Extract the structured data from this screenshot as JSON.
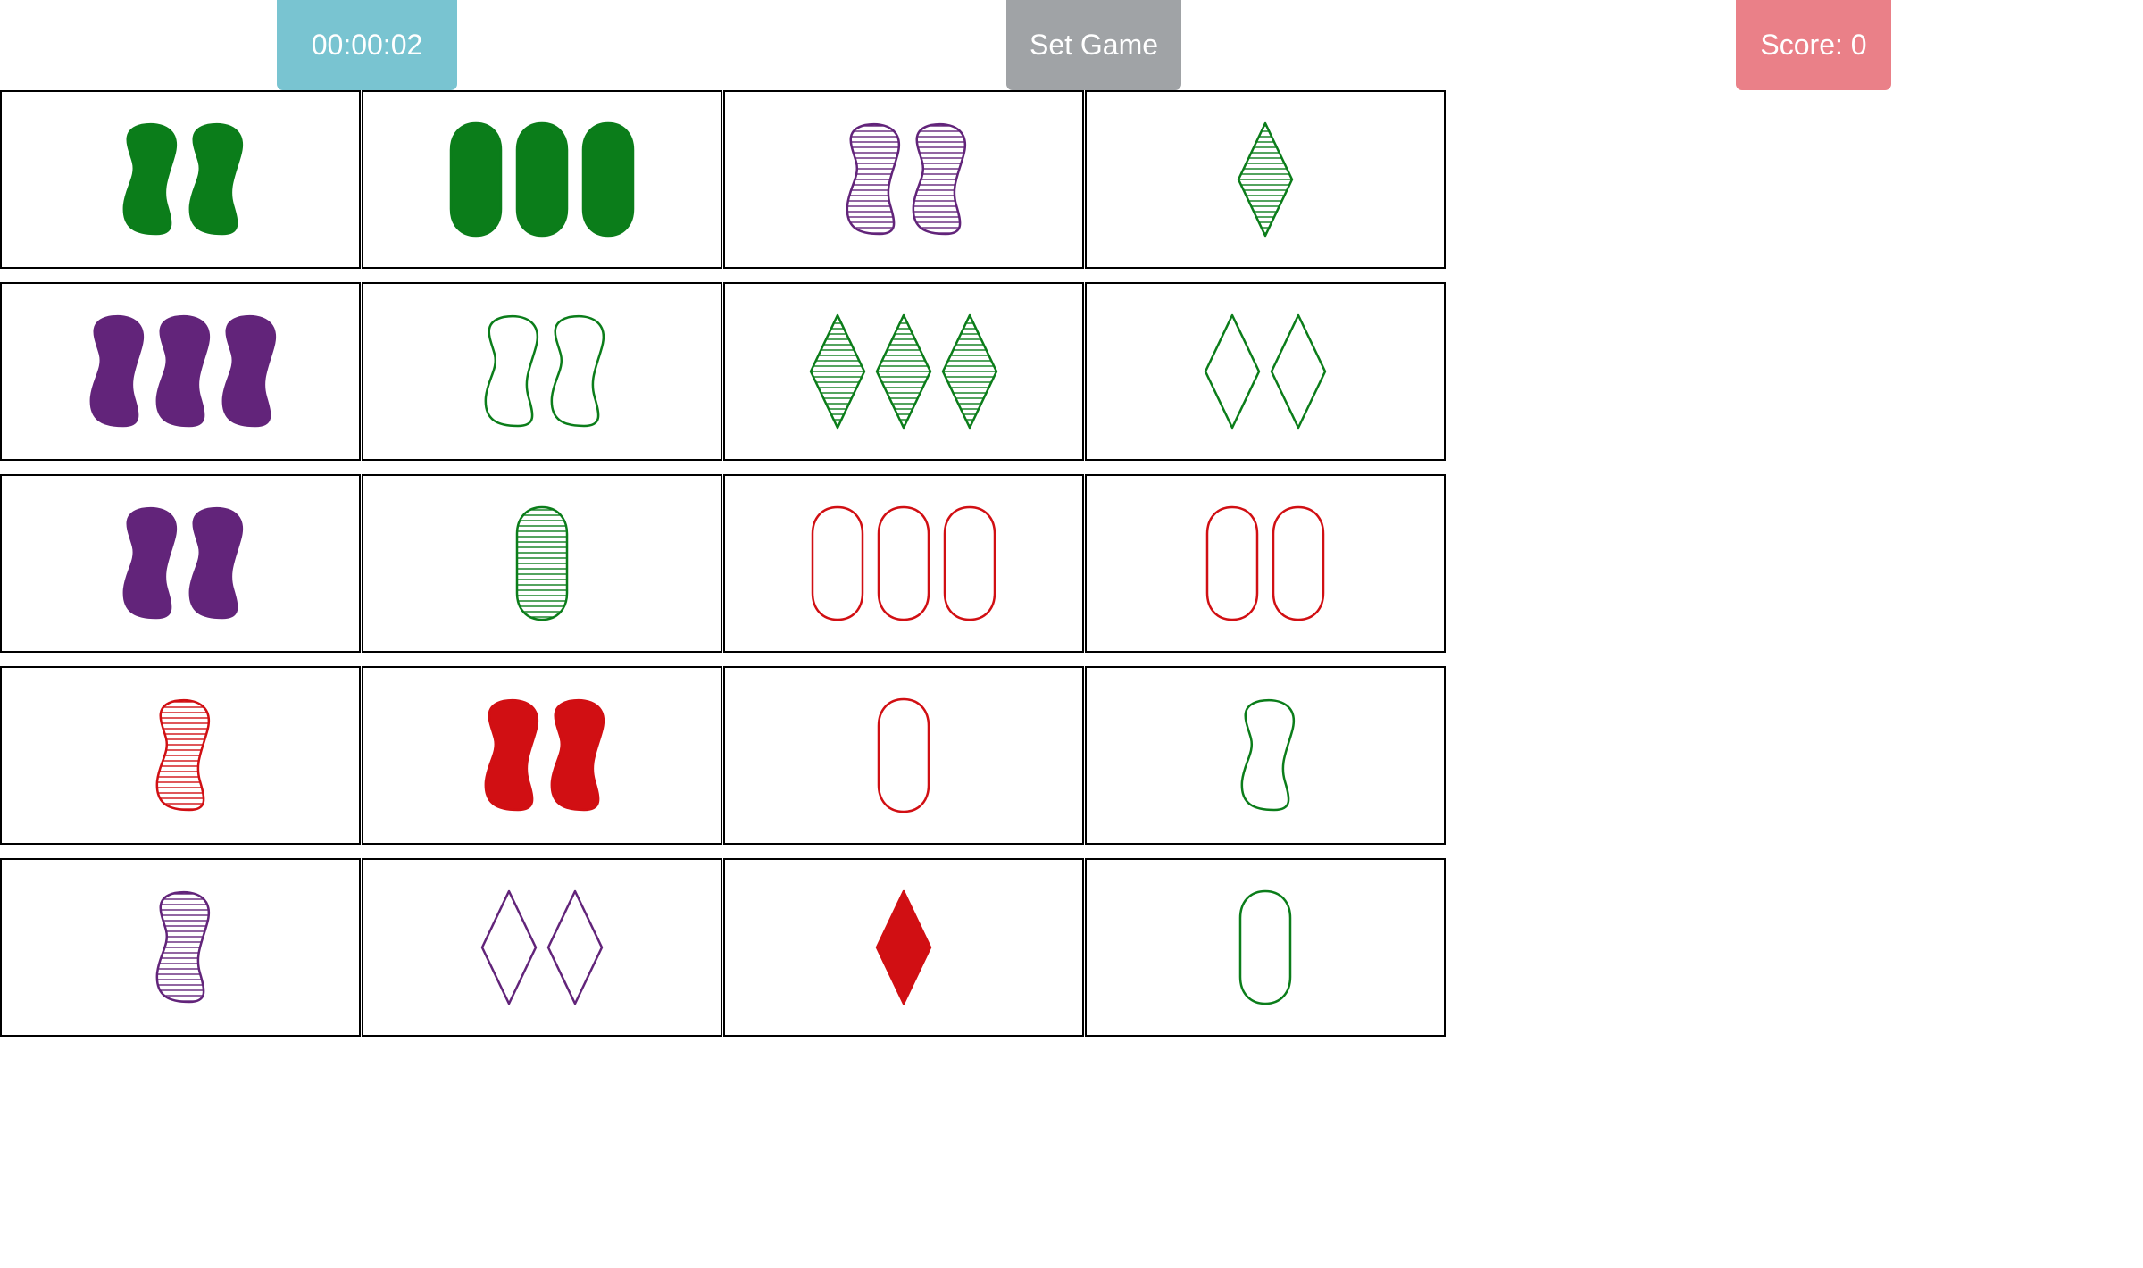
{
  "toolbar": {
    "timer_label": "00:00:02",
    "set_game_label": "Set Game",
    "score_label": "Score: 0",
    "colors": {
      "timer_bg": "#79c4d1",
      "set_game_bg": "#a0a3a6",
      "score_bg": "#ea8088"
    }
  },
  "palette": {
    "green": "#0b7d1a",
    "purple": "#62247a",
    "red": "#d10f13"
  },
  "board": {
    "rows": 5,
    "cols": 4,
    "cards": [
      {
        "number": 2,
        "shape": "squiggle",
        "fill": "solid",
        "color": "green"
      },
      {
        "number": 3,
        "shape": "oval",
        "fill": "solid",
        "color": "green"
      },
      {
        "number": 2,
        "shape": "squiggle",
        "fill": "striped",
        "color": "purple"
      },
      {
        "number": 1,
        "shape": "diamond",
        "fill": "striped",
        "color": "green"
      },
      {
        "number": 3,
        "shape": "squiggle",
        "fill": "solid",
        "color": "purple"
      },
      {
        "number": 2,
        "shape": "squiggle",
        "fill": "outline",
        "color": "green"
      },
      {
        "number": 3,
        "shape": "diamond",
        "fill": "striped",
        "color": "green"
      },
      {
        "number": 2,
        "shape": "diamond",
        "fill": "outline",
        "color": "green"
      },
      {
        "number": 2,
        "shape": "squiggle",
        "fill": "solid",
        "color": "purple"
      },
      {
        "number": 1,
        "shape": "oval",
        "fill": "striped",
        "color": "green"
      },
      {
        "number": 3,
        "shape": "oval",
        "fill": "outline",
        "color": "red"
      },
      {
        "number": 2,
        "shape": "oval",
        "fill": "outline",
        "color": "red"
      },
      {
        "number": 1,
        "shape": "squiggle",
        "fill": "striped",
        "color": "red"
      },
      {
        "number": 2,
        "shape": "squiggle",
        "fill": "solid",
        "color": "red"
      },
      {
        "number": 1,
        "shape": "oval",
        "fill": "outline",
        "color": "red"
      },
      {
        "number": 1,
        "shape": "squiggle",
        "fill": "outline",
        "color": "green"
      },
      {
        "number": 1,
        "shape": "squiggle",
        "fill": "striped",
        "color": "purple"
      },
      {
        "number": 2,
        "shape": "diamond",
        "fill": "outline",
        "color": "purple"
      },
      {
        "number": 1,
        "shape": "diamond",
        "fill": "solid",
        "color": "red"
      },
      {
        "number": 1,
        "shape": "oval",
        "fill": "outline",
        "color": "green"
      }
    ]
  }
}
